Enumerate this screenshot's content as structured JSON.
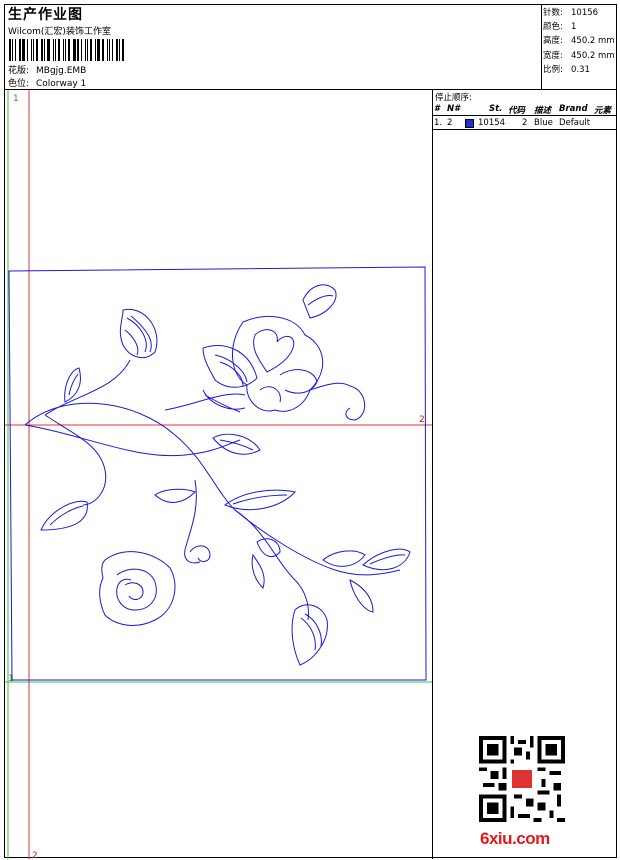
{
  "header": {
    "title": "生产作业图",
    "company": "Wilcom(汇宏)装饰工作室",
    "pattern_label": "花版:",
    "pattern_value": "MBgjg.EMB",
    "colorway_label": "色位:",
    "colorway_value": "Colorway 1"
  },
  "stats": {
    "stitches_label": "针数:",
    "stitches": "10156",
    "colors_label": "颜色:",
    "colors": "1",
    "height_label": "高度:",
    "height": "450.2 mm",
    "width_label": "宽度:",
    "width": "450.2 mm",
    "scale_label": "比例:",
    "scale": "0.31"
  },
  "stop_sequence": {
    "title": "停止顺序:",
    "columns": [
      "#",
      "N#",
      "St.",
      "代码",
      "描述",
      "Brand",
      "元素"
    ],
    "rows": [
      {
        "index": "1.",
        "needle": "2",
        "color": "#1f2fd6",
        "stitches": "10154",
        "code": "2",
        "description": "Blue",
        "brand": "Default",
        "element": ""
      }
    ]
  },
  "design": {
    "thread_color": "#1a1ad8",
    "axis_h_color": "#e0303a",
    "axis_v_color": "#d43a3a",
    "guide_color": "#3cc23c",
    "marker_top_left": "1",
    "marker_right": "2",
    "marker_bottom_left": "1",
    "marker_bottom_axis": "2"
  },
  "watermark": {
    "site": "6xiu.com"
  }
}
